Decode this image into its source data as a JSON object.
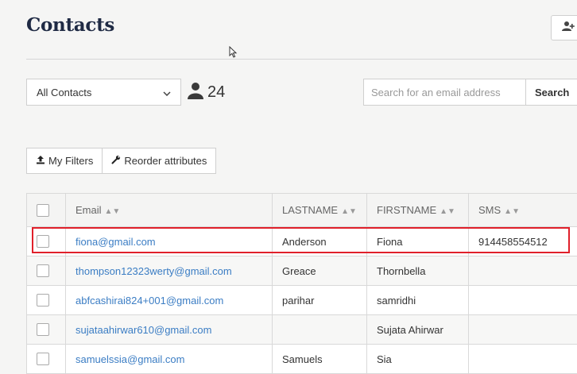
{
  "header": {
    "title": "Contacts",
    "add_contact_icon": "add-user-icon"
  },
  "filter": {
    "list_select_value": "All Contacts",
    "contact_count": "24"
  },
  "search": {
    "placeholder": "Search for an email address",
    "button_label": "Search"
  },
  "toolbar": {
    "my_filters_label": "My Filters",
    "reorder_label": "Reorder attributes"
  },
  "table": {
    "columns": [
      "Email",
      "LASTNAME",
      "FIRSTNAME",
      "SMS"
    ],
    "rows": [
      {
        "email": "fiona@gmail.com",
        "lastname": "Anderson",
        "firstname": "Fiona",
        "sms": "914458554512"
      },
      {
        "email": "thompson12323werty@gmail.com",
        "lastname": "Greace",
        "firstname": "Thornbella",
        "sms": ""
      },
      {
        "email": "abfcashirai824+001@gmail.com",
        "lastname": "parihar",
        "firstname": "samridhi",
        "sms": ""
      },
      {
        "email": "sujataahirwar610@gmail.com",
        "lastname": "",
        "firstname": "Sujata Ahirwar",
        "sms": ""
      },
      {
        "email": "samuelssia@gmail.com",
        "lastname": "Samuels",
        "firstname": "Sia",
        "sms": ""
      }
    ]
  },
  "colors": {
    "link": "#3b7dc4",
    "highlight": "#e0202a",
    "title": "#1f2a44"
  }
}
